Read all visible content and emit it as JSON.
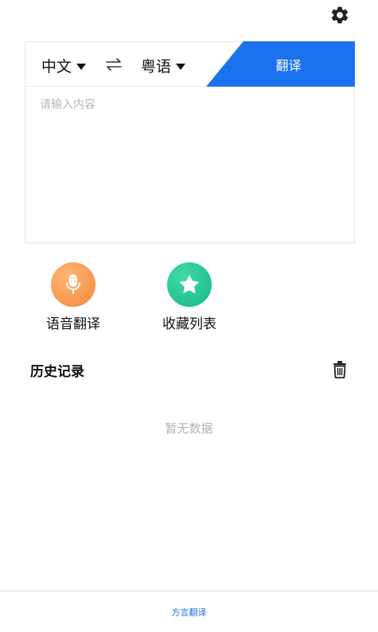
{
  "header": {
    "settings_icon": "gear-icon"
  },
  "translator": {
    "source_lang": "中文",
    "target_lang": "粤语",
    "translate_label": "翻译",
    "input_placeholder": "请输入内容",
    "input_value": "",
    "accent_color": "#1a73ec"
  },
  "actions": {
    "voice_label": "语音翻译",
    "voice_icon": "microphone-icon",
    "favorites_label": "收藏列表",
    "favorites_icon": "star-icon"
  },
  "history": {
    "title": "历史记录",
    "clear_icon": "trash-icon",
    "empty_text": "暂无数据"
  },
  "bottom_nav": {
    "tab_label": "方言翻译"
  }
}
